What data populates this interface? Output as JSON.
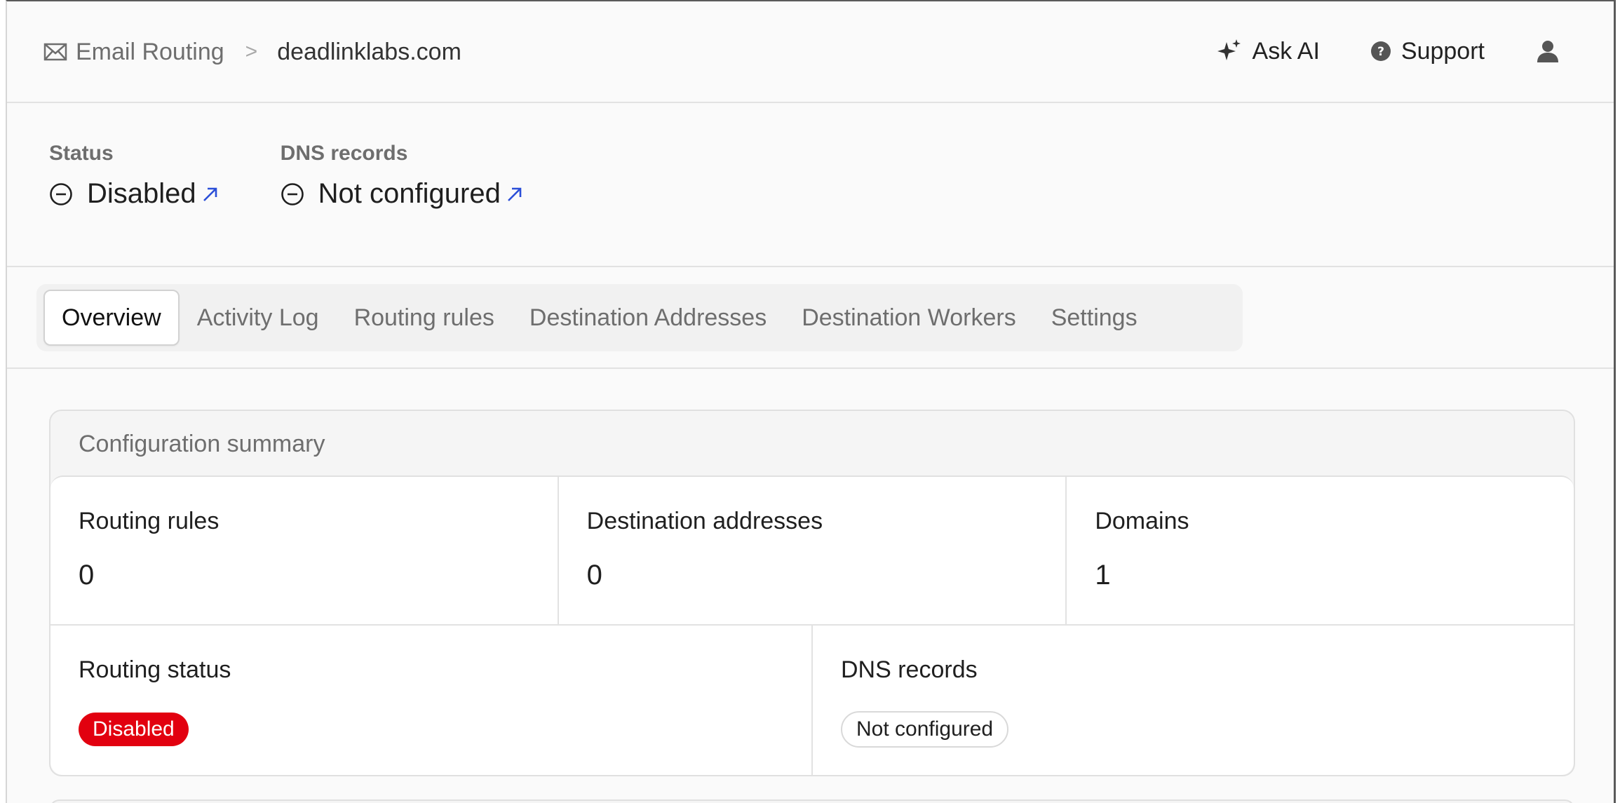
{
  "header": {
    "breadcrumb_root": "Email Routing",
    "breadcrumb_separator": ">",
    "breadcrumb_domain": "deadlinklabs.com",
    "ask_ai_label": "Ask AI",
    "support_label": "Support",
    "icons": [
      "envelope-icon",
      "chevron-right-icon",
      "sparkle-icon",
      "help-circle-icon",
      "user-icon"
    ]
  },
  "status": {
    "status_label": "Status",
    "status_value": "Disabled",
    "dns_label": "DNS records",
    "dns_value": "Not configured"
  },
  "tabs": [
    {
      "label": "Overview",
      "active": true
    },
    {
      "label": "Activity Log",
      "active": false
    },
    {
      "label": "Routing rules",
      "active": false
    },
    {
      "label": "Destination Addresses",
      "active": false
    },
    {
      "label": "Destination Workers",
      "active": false
    },
    {
      "label": "Settings",
      "active": false
    }
  ],
  "summary": {
    "title": "Configuration summary",
    "routing_rules_label": "Routing rules",
    "routing_rules_value": "0",
    "destination_addresses_label": "Destination addresses",
    "destination_addresses_value": "0",
    "domains_label": "Domains",
    "domains_value": "1",
    "routing_status_label": "Routing status",
    "routing_status_badge": "Disabled",
    "dns_records_label": "DNS records",
    "dns_records_badge": "Not configured"
  },
  "colors": {
    "accent_link": "#2b4fd8",
    "danger_badge": "#e2000f",
    "muted_text": "#6e6e6e"
  }
}
